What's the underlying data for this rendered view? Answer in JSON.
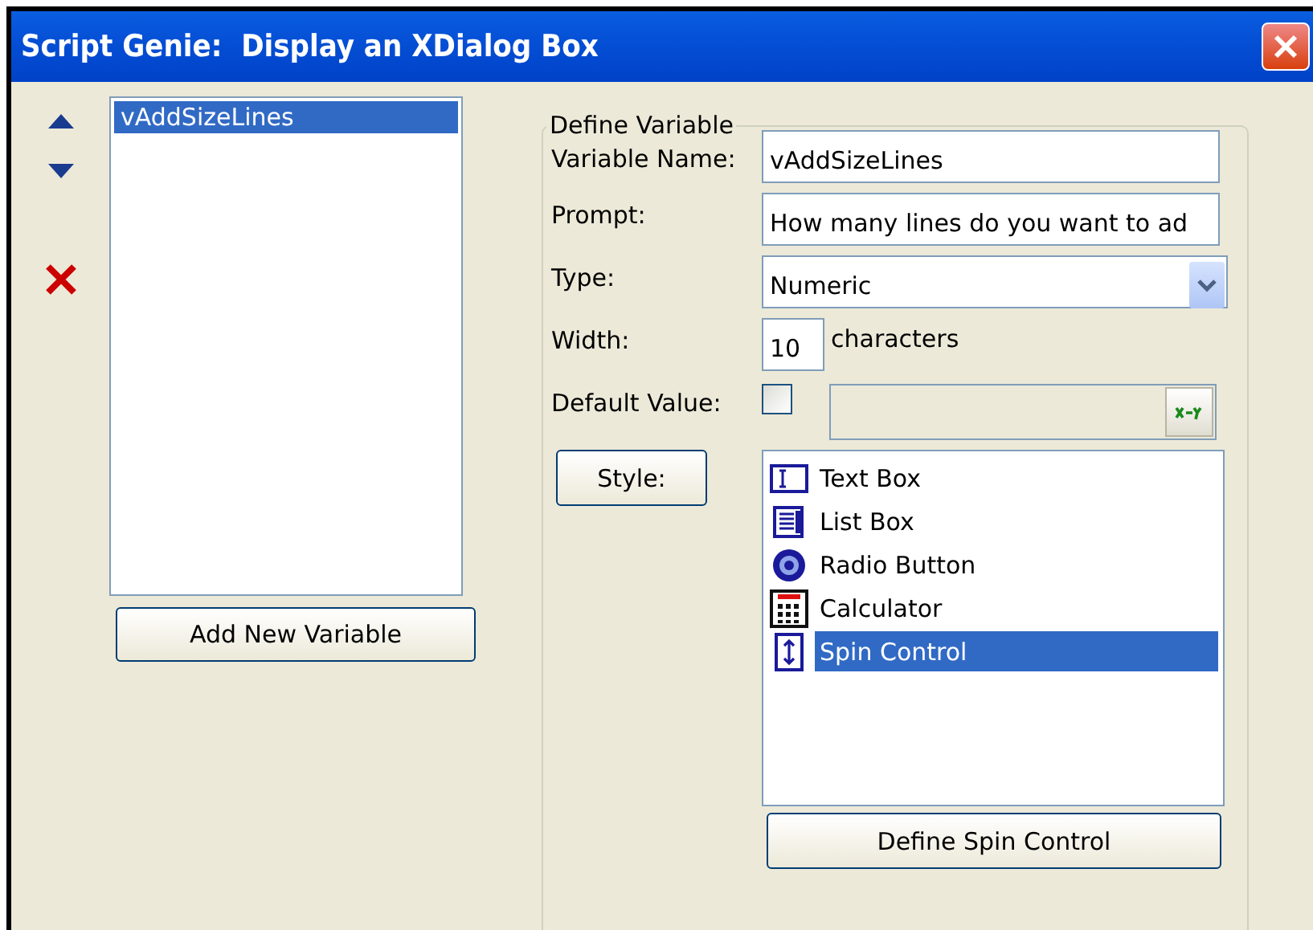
{
  "window": {
    "title": "Script Genie:  Display an XDialog Box"
  },
  "variables": {
    "items": [
      {
        "label": "vAddSizeLines",
        "selected": true
      }
    ],
    "add_button": "Add New Variable"
  },
  "define_variable": {
    "title": "Define Variable",
    "fields": [
      {
        "kind": "text",
        "label": "Variable Name:",
        "value": "vAddSizeLines"
      },
      {
        "kind": "text",
        "label": "Prompt:",
        "value": "How many lines do you want to ad"
      },
      {
        "kind": "dropdown",
        "label": "Type:",
        "value": "Numeric"
      },
      {
        "kind": "width",
        "label": "Width:",
        "value": "10",
        "suffix": "characters"
      },
      {
        "kind": "default",
        "label": "Default Value:",
        "checked": false
      }
    ],
    "style_button": "Style:",
    "styles": [
      {
        "label": "Text Box",
        "selected": false
      },
      {
        "label": "List Box",
        "selected": false
      },
      {
        "label": "Radio Button",
        "selected": false
      },
      {
        "label": "Calculator",
        "selected": false
      },
      {
        "label": "Spin Control",
        "selected": true
      }
    ],
    "define_button": "Define Spin Control"
  }
}
